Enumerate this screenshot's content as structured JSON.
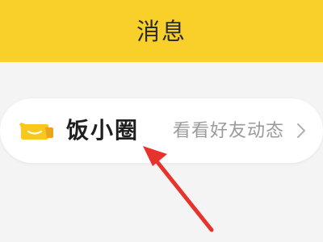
{
  "header": {
    "title": "消息"
  },
  "entry": {
    "label": "饭小圈",
    "subtitle": "看看好友动态",
    "icon": "smile-chat-icon"
  },
  "colors": {
    "header_bg": "#f9cf2a",
    "page_bg": "#f4f4f4",
    "card_bg": "#ffffff",
    "icon_yellow": "#f8c81f",
    "arrow_red": "#e7332d"
  }
}
